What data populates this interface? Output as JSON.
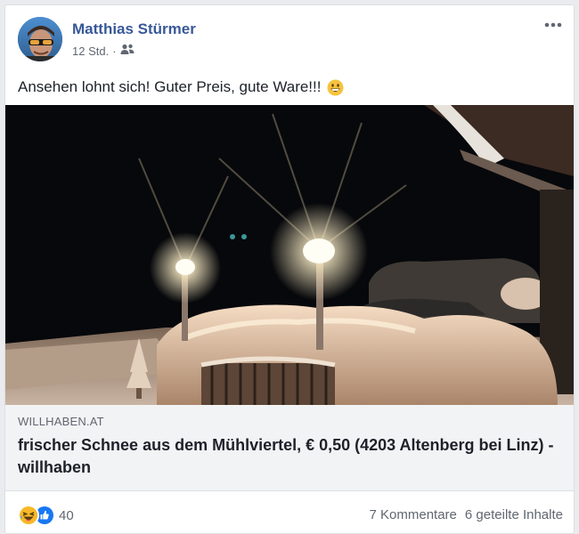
{
  "post": {
    "author": "Matthias Stürmer",
    "time": "12 Std.",
    "separator": "·",
    "audience_icon": "friends-icon",
    "text": "Ansehen lohnt sich! Guter Preis, gute Ware!!!",
    "text_emoji": "grinning-face-emoji"
  },
  "link": {
    "domain": "WILLHABEN.AT",
    "title": "frischer Schnee aus dem Mühlviertel, € 0,50 (4203 Altenberg bei Linz) - willhaben"
  },
  "footer": {
    "reaction_icons": [
      "haha-icon",
      "like-icon"
    ],
    "reaction_count": "40",
    "comments": "7 Kommentare",
    "shares": "6 geteilte Inhalte"
  },
  "colors": {
    "author_link": "#385898",
    "secondary_text": "#606770",
    "like_blue": "#1877f2",
    "haha_yellow": "#f7b928"
  }
}
